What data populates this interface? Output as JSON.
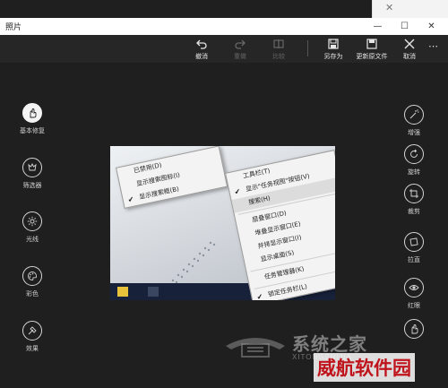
{
  "window": {
    "title": "照片",
    "minimize_glyph": "—",
    "maximize_glyph": "☐",
    "close_glyph": "✕"
  },
  "background_window": {
    "close_glyph": "✕"
  },
  "toolbar": {
    "undo": "撤消",
    "redo": "重做",
    "compare": "比较",
    "save_as": "另存为",
    "update_original": "更新原文件",
    "cancel": "取消"
  },
  "left_tools": {
    "basic_fix": "基本修复",
    "filters": "筛选器",
    "light": "光线",
    "color": "彩色",
    "effects": "效果"
  },
  "right_tools": {
    "enhance": "增强",
    "rotate": "旋转",
    "crop": "裁剪",
    "straighten": "拉直",
    "red_eye": "红眼"
  },
  "photo": {
    "menu_left": [
      "已禁用(D)",
      "显示搜索图标(I)",
      "显示搜索框(B)"
    ],
    "menu_right": [
      "工具栏(T)",
      "显示\"任务视图\"按钮(V)",
      "搜索(H)",
      "层叠窗口(D)",
      "堆叠显示窗口(E)",
      "并排显示窗口(I)",
      "显示桌面(S)",
      "任务管理器(K)",
      "锁定任务栏(L)"
    ]
  },
  "watermark": {
    "brand": "系统之家",
    "sub": "XITONGZHIJIA",
    "site": "威航软件园"
  },
  "colors": {
    "accent_red": "#c0141c",
    "background": "#1f1f1f",
    "toolbar": "#262626"
  }
}
